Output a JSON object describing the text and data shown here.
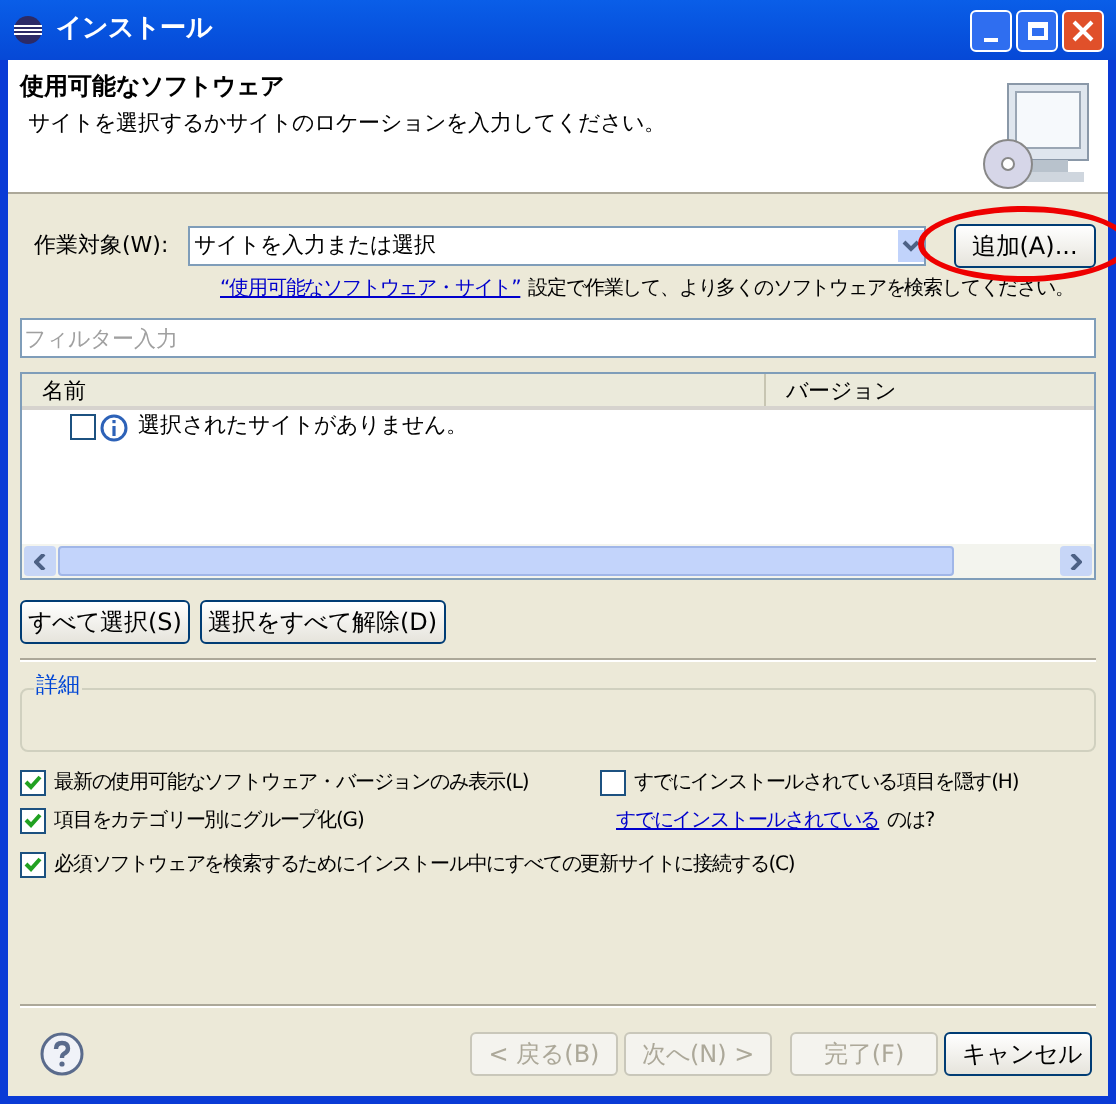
{
  "window": {
    "title": "インストール"
  },
  "header": {
    "title": "使用可能なソフトウェア",
    "subtitle": "サイトを選択するかサイトのロケーションを入力してください。"
  },
  "work_with": {
    "label": "作業対象(W):",
    "value": "サイトを入力または選択",
    "add_button": "追加(A)...",
    "highlighted": true
  },
  "sites_hint": {
    "link": "“使用可能なソフトウェア・サイト”",
    "text": "設定で作業して、より多くのソフトウェアを検索してください。"
  },
  "filter": {
    "placeholder": "フィルター入力"
  },
  "table": {
    "columns": [
      "名前",
      "バージョン"
    ],
    "rows": [
      {
        "checked": false,
        "text": "選択されたサイトがありません。"
      }
    ]
  },
  "selection_buttons": [
    "すべて選択(S)",
    "選択をすべて解除(D)"
  ],
  "details": {
    "label": "詳細"
  },
  "options": [
    {
      "label": "最新の使用可能なソフトウェア・バージョンのみ表示(L)",
      "checked": true
    },
    {
      "label": "すでにインストールされている項目を隠す(H)",
      "checked": false
    },
    {
      "label": "項目をカテゴリー別にグループ化(G)",
      "checked": true
    },
    {
      "label": "必須ソフトウェアを検索するためにインストール中にすべての更新サイトに接続する(C)",
      "checked": true
    }
  ],
  "installed_hint": {
    "link": "すでにインストールされている",
    "text": "のは?"
  },
  "footer_buttons": [
    {
      "label": "< 戻る(B)",
      "disabled": true
    },
    {
      "label": "次へ(N) >",
      "disabled": true
    },
    {
      "label": "完了(F)",
      "disabled": true
    },
    {
      "label": "キャンセル",
      "disabled": false
    }
  ]
}
